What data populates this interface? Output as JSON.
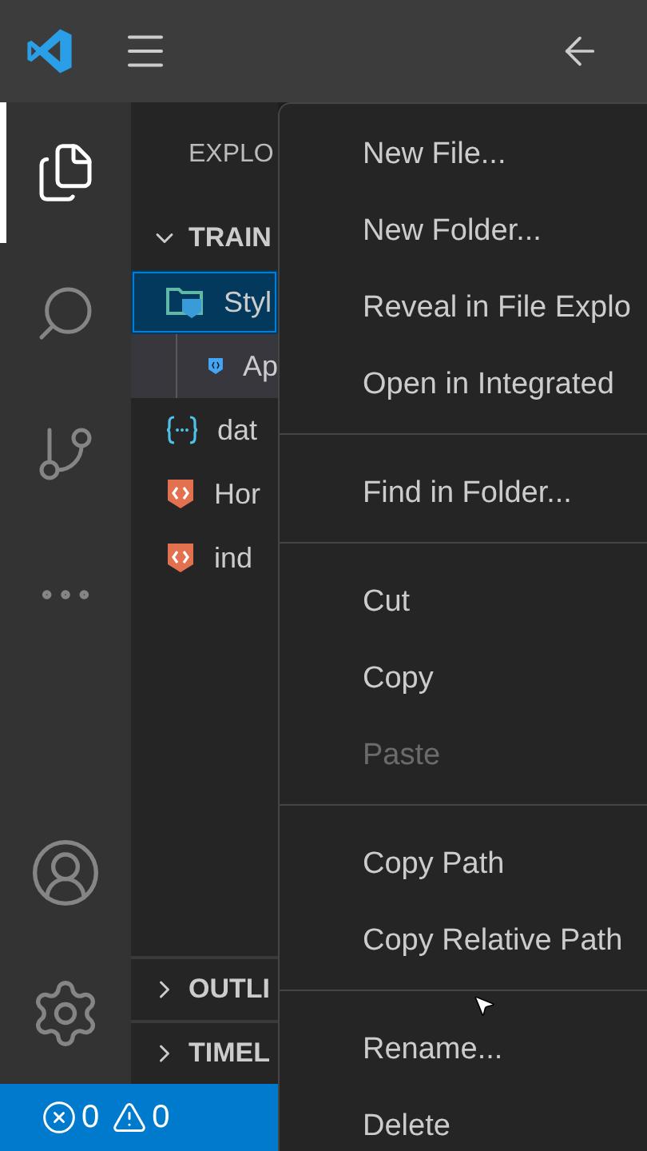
{
  "activity_bar": {
    "top_items": [
      {
        "selected": true
      },
      {
        "selected": false
      },
      {
        "selected": false
      },
      {
        "selected": false
      }
    ],
    "bottom_items": [
      {
        "selected": false
      },
      {
        "selected": false
      }
    ]
  },
  "sidebar": {
    "title": "EXPLO",
    "folder": {
      "label": "TRAIN",
      "expanded": true,
      "children": [
        {
          "label": "Styl",
          "kind": "folder",
          "selected": true,
          "hovered": false,
          "children": [
            {
              "label": "Ap",
              "kind": "style",
              "selected": false,
              "hovered": true
            }
          ]
        },
        {
          "label": "dat",
          "kind": "json",
          "selected": false,
          "hovered": false
        },
        {
          "label": "Hor",
          "kind": "html",
          "selected": false,
          "hovered": false
        },
        {
          "label": "ind",
          "kind": "html",
          "selected": false,
          "hovered": false
        }
      ]
    },
    "panels": [
      {
        "label": "OUTLI",
        "expanded": false
      },
      {
        "label": "TIMEL",
        "expanded": false
      }
    ]
  },
  "context_menu": {
    "groups": [
      [
        {
          "label": "New File...",
          "disabled": false
        },
        {
          "label": "New Folder...",
          "disabled": false
        },
        {
          "label": "Reveal in File Explo",
          "disabled": false
        },
        {
          "label": "Open in Integrated",
          "disabled": false
        }
      ],
      [
        {
          "label": "Find in Folder...",
          "disabled": false
        }
      ],
      [
        {
          "label": "Cut",
          "disabled": false
        },
        {
          "label": "Copy",
          "disabled": false
        },
        {
          "label": "Paste",
          "disabled": true
        }
      ],
      [
        {
          "label": "Copy Path",
          "disabled": false
        },
        {
          "label": "Copy Relative Path",
          "disabled": false
        }
      ],
      [
        {
          "label": "Rename...",
          "disabled": false
        },
        {
          "label": "Delete",
          "disabled": false
        }
      ]
    ]
  },
  "status_bar": {
    "errors": "0",
    "warnings": "0"
  }
}
